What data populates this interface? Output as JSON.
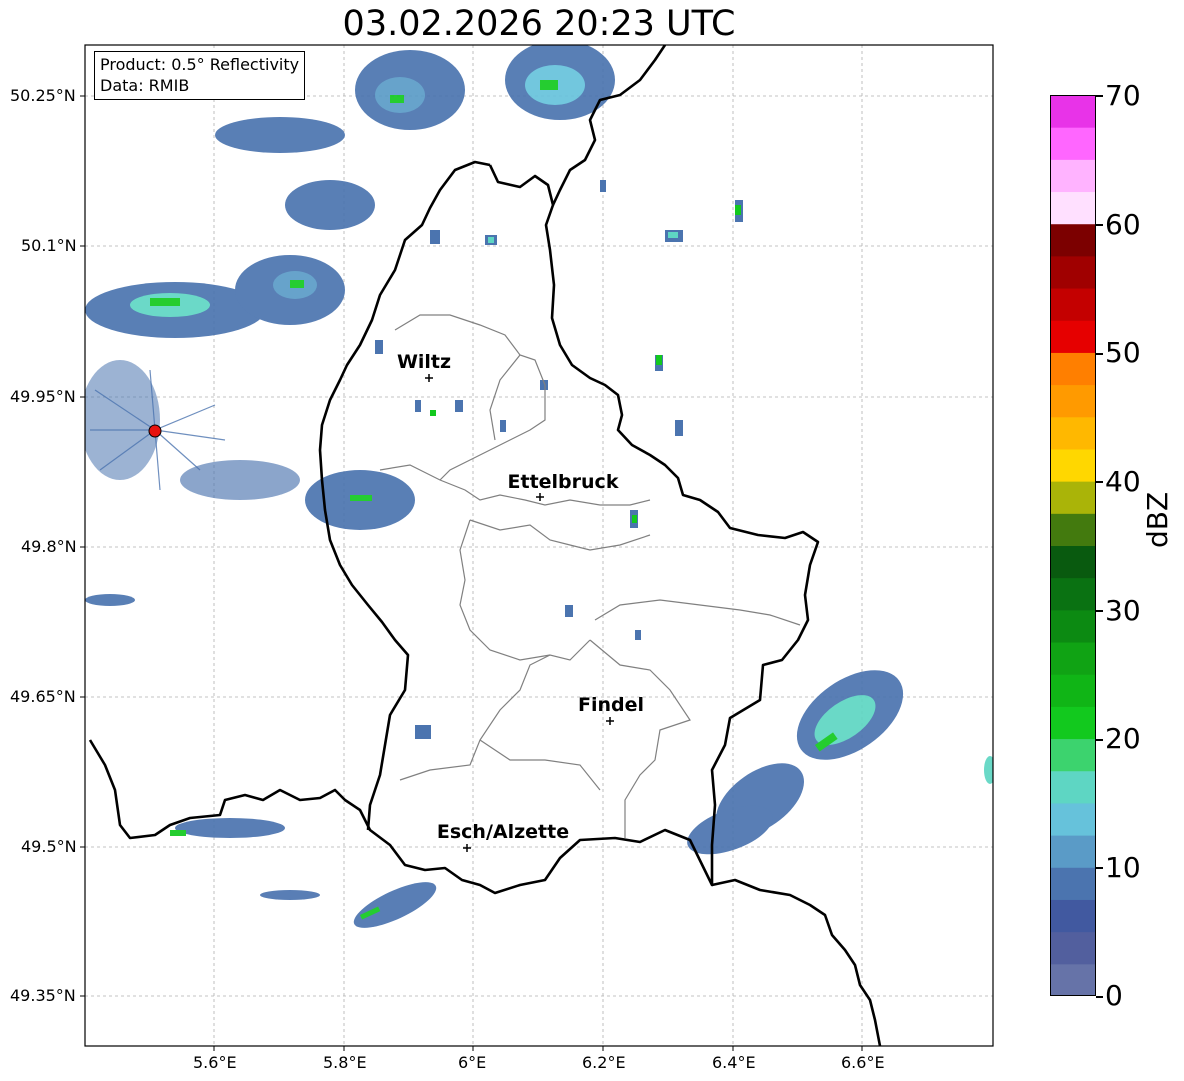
{
  "title": "03.02.2026 20:23 UTC",
  "info_box": {
    "product": "Product: 0.5° Reflectivity",
    "source": "Data: RMIB"
  },
  "axes": {
    "lat_labels": [
      "50.25°N",
      "50.1°N",
      "49.95°N",
      "49.8°N",
      "49.65°N",
      "49.5°N",
      "49.35°N"
    ],
    "lon_labels": [
      "5.6°E",
      "5.8°E",
      "6°E",
      "6.2°E",
      "6.4°E",
      "6.6°E"
    ],
    "lat_range": [
      49.3,
      50.3
    ],
    "lon_range": [
      5.4,
      6.8
    ]
  },
  "cities": [
    {
      "name": "Wiltz",
      "lat": 49.966,
      "lon": 5.933
    },
    {
      "name": "Ettelbruck",
      "lat": 49.847,
      "lon": 6.104
    },
    {
      "name": "Findel",
      "lat": 49.627,
      "lon": 6.211
    },
    {
      "name": "Esch/Alzette",
      "lat": 49.497,
      "lon": 5.986
    }
  ],
  "radar_site": {
    "lat": 49.914,
    "lon": 5.505,
    "color": "#e8130f"
  },
  "colorbar": {
    "label": "dBZ",
    "ticks": [
      "0",
      "10",
      "20",
      "30",
      "40",
      "50",
      "60",
      "70"
    ],
    "range": [
      0,
      70
    ],
    "colors": [
      "#6673a8",
      "#525f9e",
      "#4159a0",
      "#4b74af",
      "#5a9bc7",
      "#66c2db",
      "#5ed6c3",
      "#3cd36e",
      "#12c91e",
      "#10b516",
      "#10a314",
      "#0c8a12",
      "#0a7212",
      "#095a0f",
      "#437a0e",
      "#aab408",
      "#ffd700",
      "#ffb800",
      "#ff9a00",
      "#ff7f00",
      "#e60000",
      "#c40000",
      "#a00000",
      "#7c0000",
      "#ffe0ff",
      "#ffb3ff",
      "#ff66ff",
      "#e833e8"
    ]
  }
}
